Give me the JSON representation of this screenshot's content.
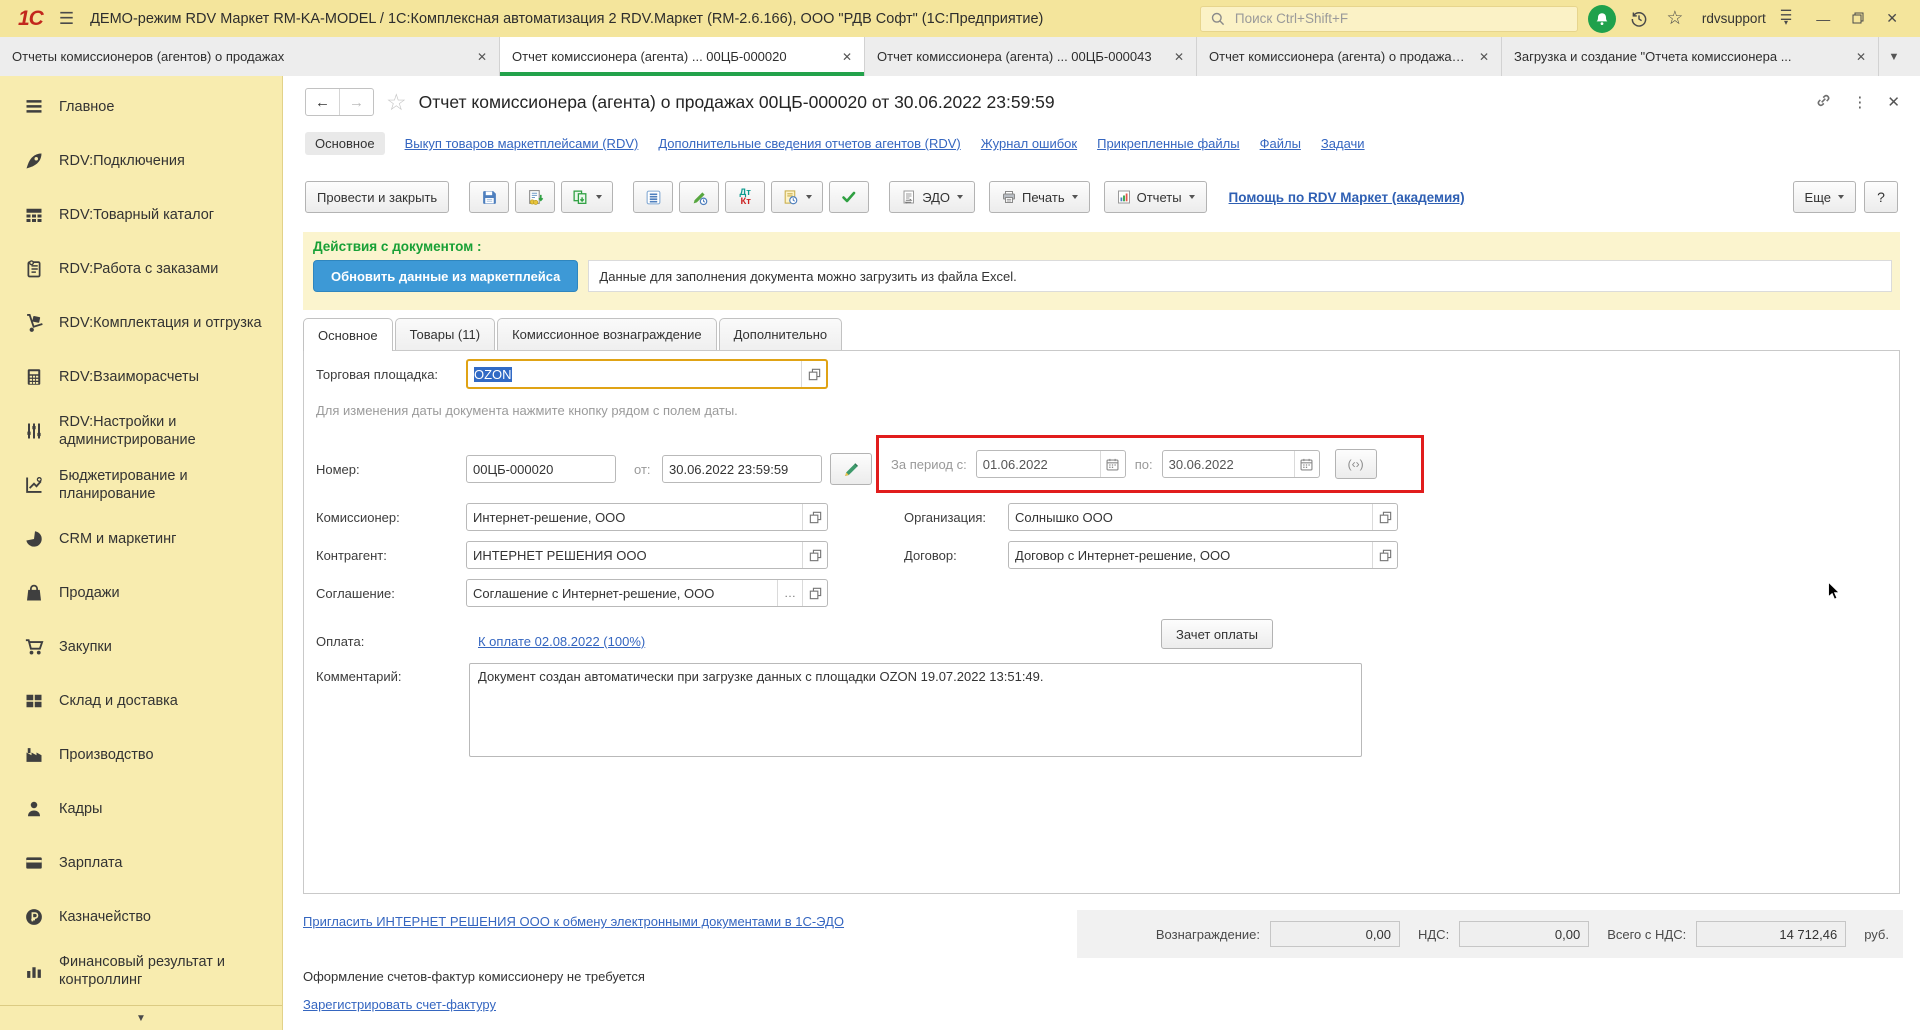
{
  "topbar": {
    "logo": "1С",
    "title": "ДЕМО-режим RDV Маркет RM-KA-MODEL / 1С:Комплексная автоматизация 2 RDV.Маркет (RM-2.6.166), ООО \"РДВ Софт\"  (1С:Предприятие)",
    "search_placeholder": "Поиск Ctrl+Shift+F",
    "user": "rdvsupport"
  },
  "tabs": [
    {
      "label": "Отчеты комиссионеров (агентов) о продажах",
      "active": false
    },
    {
      "label": "Отчет комиссионера (агента) ...  00ЦБ-000020",
      "active": true
    },
    {
      "label": "Отчет комиссионера (агента) ...  00ЦБ-000043",
      "active": false
    },
    {
      "label": "Отчет комиссионера (агента) о продажах (с...",
      "active": false
    },
    {
      "label": "Загрузка и создание \"Отчета комиссионера ...",
      "active": false
    }
  ],
  "sidebar": {
    "items": [
      {
        "key": "main",
        "icon": "menu",
        "label": "Главное"
      },
      {
        "key": "rdv-connections",
        "icon": "rocket",
        "label": "RDV:Подключения"
      },
      {
        "key": "rdv-catalog",
        "icon": "catalog",
        "label": "RDV:Товарный каталог"
      },
      {
        "key": "rdv-orders",
        "icon": "orders",
        "label": "RDV:Работа с заказами"
      },
      {
        "key": "rdv-shipping",
        "icon": "shipping",
        "label": "RDV:Комплектация и отгрузка"
      },
      {
        "key": "rdv-settlements",
        "icon": "calculator",
        "label": "RDV:Взаиморасчеты"
      },
      {
        "key": "rdv-admin",
        "icon": "settings",
        "label": "RDV:Настройки и администрирование"
      },
      {
        "key": "budgeting",
        "icon": "planning",
        "label": "Бюджетирование и планирование"
      },
      {
        "key": "crm",
        "icon": "crm",
        "label": "CRM и маркетинг"
      },
      {
        "key": "sales",
        "icon": "sales",
        "label": "Продажи"
      },
      {
        "key": "purchases",
        "icon": "purchases",
        "label": "Закупки"
      },
      {
        "key": "warehouse",
        "icon": "warehouse",
        "label": "Склад и доставка"
      },
      {
        "key": "production",
        "icon": "production",
        "label": "Производство"
      },
      {
        "key": "hr",
        "icon": "hr",
        "label": "Кадры"
      },
      {
        "key": "salary",
        "icon": "salary",
        "label": "Зарплата"
      },
      {
        "key": "treasury",
        "icon": "treasury",
        "label": "Казначейство"
      },
      {
        "key": "finance",
        "icon": "finance",
        "label": "Финансовый результат и контроллинг"
      }
    ]
  },
  "doc": {
    "title": "Отчет комиссионера (агента) о продажах 00ЦБ-000020 от 30.06.2022 23:59:59",
    "nav": {
      "active": "Основное",
      "links": [
        "Выкуп товаров маркетплейсами (RDV)",
        "Дополнительные сведения отчетов агентов (RDV)",
        "Журнал ошибок",
        "Прикрепленные файлы",
        "Файлы",
        "Задачи"
      ]
    },
    "toolbar": {
      "post_and_close": "Провести и закрыть",
      "dtkt_top": "Дт",
      "dtkt_bottom": "Кт",
      "edo": "ЭДО",
      "print": "Печать",
      "reports": "Отчеты",
      "help_link": "Помощь по RDV Маркет (академия)",
      "more": "Еще",
      "help": "?"
    },
    "actions": {
      "header": "Действия с документом :",
      "refresh": "Обновить данные из маркетплейса",
      "hint": "Данные для заполнения документа можно загрузить из файла Excel."
    },
    "form_tabs": [
      {
        "label": "Основное",
        "active": true
      },
      {
        "label": "Товары (11)",
        "active": false
      },
      {
        "label": "Комиссионное вознаграждение",
        "active": false
      },
      {
        "label": "Дополнительно",
        "active": false
      }
    ],
    "form": {
      "marketplace_label": "Торговая площадка:",
      "marketplace_value": "OZON",
      "date_hint": "Для изменения даты документа нажмите кнопку рядом с полем даты.",
      "number_label": "Номер:",
      "number_value": "00ЦБ-000020",
      "from_label": "от:",
      "from_value": "30.06.2022 23:59:59",
      "period_from_label": "За период с:",
      "period_from_value": "01.06.2022",
      "period_to_label": "по:",
      "period_to_value": "30.06.2022",
      "period_picker_glyph": "(‹›)",
      "commissioner_label": "Комиссионер:",
      "commissioner_value": "Интернет-решение, ООО",
      "organization_label": "Организация:",
      "organization_value": "Солнышко ООО",
      "counterparty_label": "Контрагент:",
      "counterparty_value": "ИНТЕРНЕТ РЕШЕНИЯ ООО",
      "contract_label": "Договор:",
      "contract_value": "Договор с Интернет-решение, ООО",
      "agreement_label": "Соглашение:",
      "agreement_value": "Соглашение с Интернет-решение, ООО",
      "agreement_more": "…",
      "payment_label": "Оплата:",
      "payment_link": "К оплате 02.08.2022 (100%)",
      "offset_button": "Зачет оплаты",
      "comment_label": "Комментарий:",
      "comment_value": "Документ создан автоматически при загрузке данных с площадки OZON 19.07.2022 13:51:49."
    },
    "footer": {
      "edo_invite_link": "Пригласить ИНТЕРНЕТ РЕШЕНИЯ ООО к обмену электронными документами в 1С-ЭДО",
      "totals": [
        {
          "label": "Вознаграждение:",
          "value": "0,00"
        },
        {
          "label": "НДС:",
          "value": "0,00"
        },
        {
          "label": "Всего с НДС:",
          "value": "14 712,46"
        }
      ],
      "currency": "руб.",
      "invoice_note": "Оформление счетов-фактур комиссионеру не требуется",
      "register_invoice_link": "Зарегистрировать счет-фактуру"
    }
  },
  "colors": {
    "topbar_bg": "#F4E59C",
    "sidebar_bg": "#F8ECAF",
    "active_tab_green": "#23A24B",
    "action_green": "#18A036",
    "button_blue": "#3D99D6",
    "link_blue": "#3566C0",
    "highlight_red": "#E11C1C",
    "selection_blue": "#316AC5",
    "focus_gold": "#E0A315"
  }
}
